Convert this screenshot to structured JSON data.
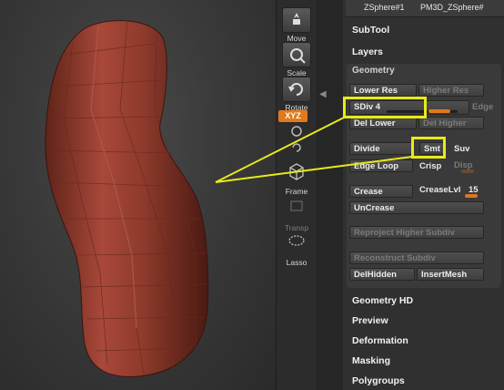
{
  "tools": {
    "move": "Move",
    "scale": "Scale",
    "rotate": "Rotate",
    "xyz": "XYZ",
    "frame": "Frame",
    "transp": "Transp",
    "lasso": "Lasso"
  },
  "subtool_tabs": [
    "ZSphere#1",
    "PM3D_ZSphere#"
  ],
  "sections_top": [
    "SubTool",
    "Layers"
  ],
  "geometry": {
    "title": "Geometry",
    "lower_res": "Lower Res",
    "higher_res": "Higher Res",
    "sdiv_label": "SDiv 4",
    "sdiv_value": 4,
    "edge": "Edge",
    "del_lower": "Del Lower",
    "del_higher": "Del Higher",
    "divide": "Divide",
    "smt": "Smt",
    "suv": "Suv",
    "edge_loop": "Edge Loop",
    "crisp": "Crisp",
    "disp": "Disp",
    "crease": "Crease",
    "crease_lvl_label": "CreaseLvl",
    "crease_lvl_value": "15",
    "uncrease": "UnCrease",
    "reproject": "Reproject Higher Subdiv",
    "reconstruct": "Reconstruct Subdiv",
    "del_hidden": "DelHidden",
    "insert_mesh": "InsertMesh"
  },
  "sections_bottom": [
    "Geometry HD",
    "Preview",
    "Deformation",
    "Masking",
    "Polygroups"
  ],
  "colors": {
    "accent": "#e0761e",
    "highlight": "#e8ea1a",
    "model": "#8e3a2a"
  },
  "icons": [
    "move-icon",
    "scale-icon",
    "rotate-icon",
    "frame-icon",
    "transp-icon",
    "lasso-icon"
  ]
}
